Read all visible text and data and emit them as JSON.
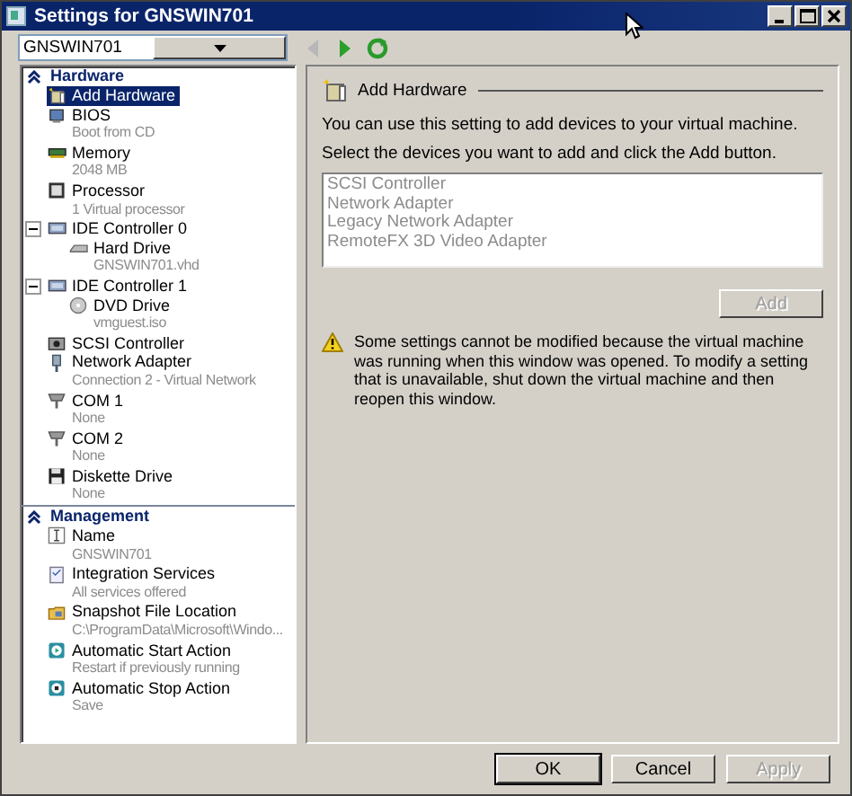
{
  "window": {
    "title": "Settings for GNSWIN701"
  },
  "vm_selector": {
    "value": "GNSWIN701"
  },
  "toolbar_buttons": [
    {
      "disabled": true
    },
    {
      "disabled": false
    },
    {
      "disabled": false
    }
  ],
  "tree": [
    {
      "heading": "Hardware",
      "expanded": true,
      "items": [
        {
          "label": "Add Hardware",
          "selected": true
        },
        {
          "label": "BIOS",
          "detail": "Boot from CD",
          "selected": false
        },
        {
          "label": "Memory",
          "detail": "2048 MB",
          "selected": false
        },
        {
          "label": "Processor",
          "detail": "1 Virtual processor",
          "selected": false
        },
        {
          "label": "IDE Controller 0",
          "selected": false,
          "expanded": true,
          "children": [
            {
              "label": "Hard Drive",
              "detail": "GNSWIN701.vhd",
              "selected": false
            }
          ]
        },
        {
          "label": "IDE Controller 1",
          "selected": false,
          "expanded": true,
          "children": [
            {
              "label": "DVD Drive",
              "detail": "vmguest.iso",
              "selected": false
            }
          ]
        },
        {
          "label": "SCSI Controller",
          "selected": false
        },
        {
          "label": "Network Adapter",
          "detail": "Connection 2 - Virtual Network",
          "selected": false
        },
        {
          "label": "COM 1",
          "detail": "None",
          "selected": false
        },
        {
          "label": "COM 2",
          "detail": "None",
          "selected": false
        },
        {
          "label": "Diskette Drive",
          "detail": "None",
          "selected": false
        }
      ]
    },
    {
      "heading": "Management",
      "expanded": true,
      "items": [
        {
          "label": "Name",
          "detail": "GNSWIN701",
          "selected": false
        },
        {
          "label": "Integration Services",
          "detail": "All services offered",
          "selected": false
        },
        {
          "label": "Snapshot File Location",
          "detail": "C:\\ProgramData\\Microsoft\\Windo...",
          "selected": false
        },
        {
          "label": "Automatic Start Action",
          "detail": "Restart if previously running",
          "selected": false
        },
        {
          "label": "Automatic Stop Action",
          "detail": "Save",
          "selected": false
        }
      ]
    }
  ],
  "panel": {
    "title": "Add Hardware",
    "description": [
      "You can use this setting to add devices to your virtual machine.",
      "Select the devices you want to add and click the Add button."
    ],
    "devices": {
      "disabled": true,
      "items": [
        "SCSI Controller",
        "Network Adapter",
        "Legacy Network Adapter",
        "RemoteFX 3D Video Adapter"
      ]
    },
    "add_button": {
      "label": "Add",
      "disabled": true
    },
    "warning": "Some settings cannot be modified because the virtual machine was running when this window was opened. To modify a setting that is unavailable, shut down the virtual machine and then reopen this window."
  },
  "buttons": [
    {
      "label": "OK",
      "disabled": false
    },
    {
      "label": "Cancel",
      "disabled": false
    },
    {
      "label": "Apply",
      "disabled": true
    }
  ]
}
